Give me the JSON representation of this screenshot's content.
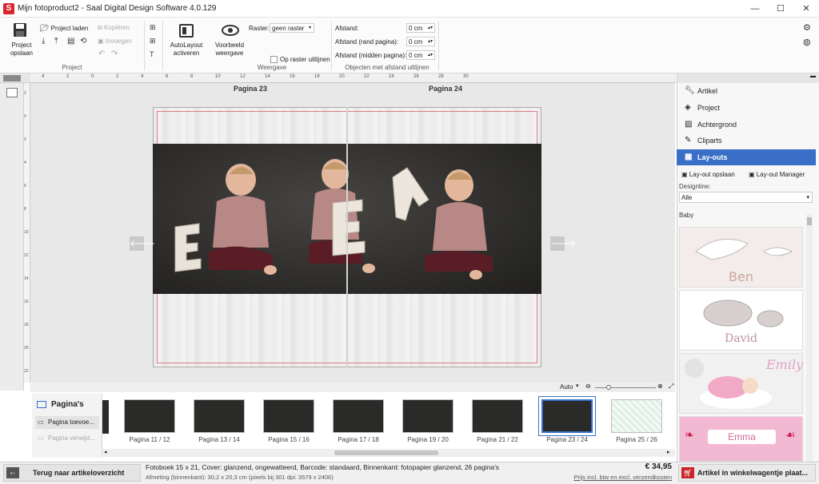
{
  "window": {
    "title": "Mijn fotoproduct2 - Saal Digital Design Software 4.0.129",
    "app_icon": "S",
    "minimize": "—",
    "maximize": "☐",
    "close": "✕"
  },
  "ribbon": {
    "save_label_1": "Project",
    "save_label_2": "opslaan",
    "load_label": "Project laden",
    "copy_label": "Kopiëren",
    "paste_label": "Invoegen",
    "group_project": "Project",
    "autolayout_1": "AutoLayout",
    "autolayout_2": "activeren",
    "preview_1": "Voorbeeld",
    "preview_2": "weergave",
    "raster_label": "Raster:",
    "raster_value": "geen raster",
    "snap_label": "Op raster uitlijnen",
    "group_view": "Weergave",
    "afstand_label": "Afstand:",
    "afstand_value": "0 cm",
    "afstand_rand_label": "Afstand (rand pagina):",
    "afstand_rand_value": "0 cm",
    "afstand_midden_label": "Afstand (midden pagina):",
    "afstand_midden_value": "0 cm",
    "group_align": "Objecten met afstand uitlijnen"
  },
  "ruler": {
    "top": [
      "4",
      "2",
      "0",
      "2",
      "4",
      "6",
      "8",
      "10",
      "12",
      "14",
      "16",
      "18",
      "20",
      "22",
      "24",
      "26",
      "28",
      "30"
    ],
    "left": [
      "2",
      "0",
      "2",
      "4",
      "6",
      "8",
      "10",
      "12",
      "14",
      "16",
      "18",
      "20",
      "22"
    ]
  },
  "canvas": {
    "page_left": "Pagina 23",
    "page_right": "Pagina 24",
    "arrow_left": "🡐",
    "arrow_right": "🡒"
  },
  "zoom": {
    "mode": "Auto"
  },
  "pages_panel": {
    "title": "Pagina's",
    "add": "Pagina toevoe...",
    "remove": "Pagina verwijd..."
  },
  "thumbnails": [
    {
      "label": "Pagina 11 / 12"
    },
    {
      "label": "Pagina 13 / 14"
    },
    {
      "label": "Pagina 15 / 16"
    },
    {
      "label": "Pagina 17 / 18"
    },
    {
      "label": "Pagina 19 / 20"
    },
    {
      "label": "Pagina 21 / 22"
    },
    {
      "label": "Pagina 23 / 24"
    },
    {
      "label": "Pagina 25 / 26"
    }
  ],
  "right_panel": {
    "items": [
      "Artikel",
      "Project",
      "Achtergrond",
      "Cliparts",
      "Lay-outs"
    ],
    "save_layout": "Lay-out opslaan",
    "layout_manager": "Lay-out Manager",
    "designline_label": "Designline:",
    "designline_value": "Alle",
    "category": "Baby",
    "templates": [
      "Ben",
      "David",
      "Emily",
      "Emma"
    ]
  },
  "bottom": {
    "back": "Terug naar artikeloverzicht",
    "info_1": "Fotoboek 15 x 21, Cover: glanzend, ongewatteerd, Barcode: standaard, Binnenkant: fotopapier glanzend, 26 pagina's",
    "info_2": "Afmeting (binnenkant): 30,2 x 20,3 cm (pixels bij 301 dpi: 3579 x 2406)",
    "price": "€ 34,95",
    "price_note": "Prijs incl. btw en excl. verzendkosten",
    "cart": "Artikel in winkelwagentje plaat..."
  },
  "colors": {
    "accent": "#3a6fc7",
    "brand_red": "#d9262c",
    "cart_red": "#c8262c"
  }
}
